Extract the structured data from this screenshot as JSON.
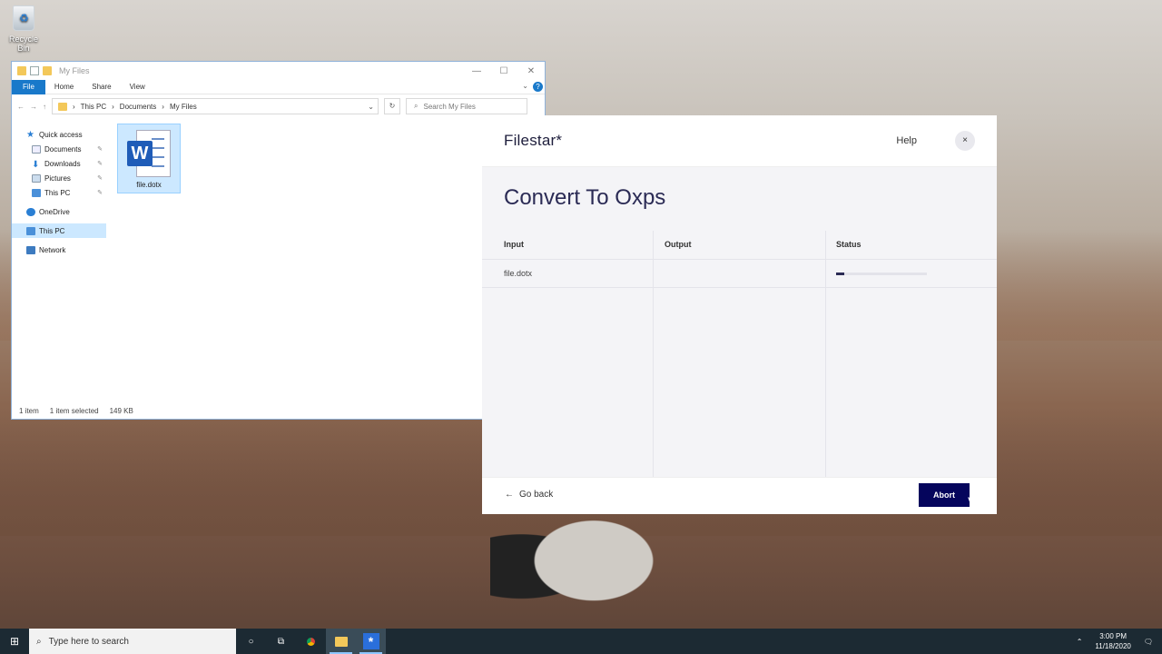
{
  "desktop": {
    "recycle_bin_label": "Recycle Bin"
  },
  "explorer": {
    "title": "My Files",
    "ribbon_tabs": [
      "File",
      "Home",
      "Share",
      "View"
    ],
    "breadcrumb": [
      "This PC",
      "Documents",
      "My Files"
    ],
    "search_placeholder": "Search My Files",
    "nav": [
      {
        "label": "Quick access",
        "pinned": false
      },
      {
        "label": "Documents",
        "pinned": true
      },
      {
        "label": "Downloads",
        "pinned": true
      },
      {
        "label": "Pictures",
        "pinned": true
      },
      {
        "label": "This PC",
        "pinned": true
      },
      {
        "label": "OneDrive",
        "pinned": false
      },
      {
        "label": "This PC",
        "pinned": false,
        "selected": true
      },
      {
        "label": "Network",
        "pinned": false
      }
    ],
    "file": {
      "name": "file.dotx",
      "icon_letter": "W"
    },
    "status": {
      "items": "1 item",
      "selected": "1 item selected",
      "size": "149 KB"
    }
  },
  "filestar": {
    "brand": "Filestar*",
    "help_label": "Help",
    "close_label": "×",
    "title": "Convert To Oxps",
    "columns": {
      "input": "Input",
      "output": "Output",
      "status": "Status"
    },
    "rows": [
      {
        "input": "file.dotx",
        "output": "",
        "progress_percent": 9
      }
    ],
    "back_label": "Go back",
    "abort_label": "Abort",
    "accent_color": "#05055c"
  },
  "taskbar": {
    "search_placeholder": "Type here to search",
    "time": "3:00 PM",
    "date": "11/18/2020"
  }
}
